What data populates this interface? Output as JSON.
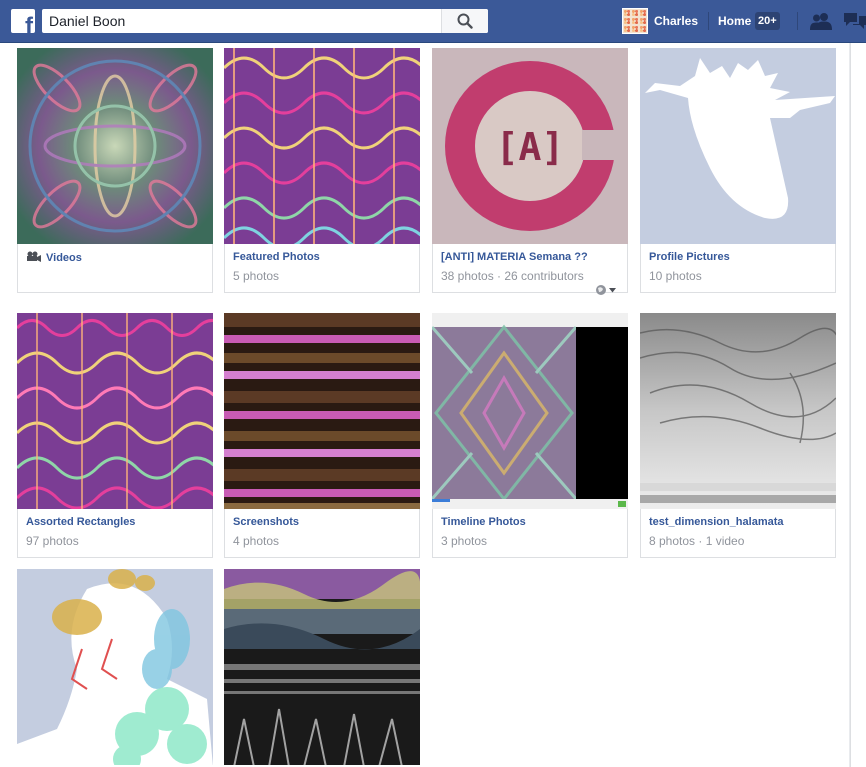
{
  "header": {
    "search_value": "Daniel Boon",
    "user_name": "Charles",
    "home_label": "Home",
    "home_badge": "20+"
  },
  "albums": [
    {
      "title": "Videos",
      "subtitle": "",
      "icon": "video-camera-icon"
    },
    {
      "title": "Featured Photos",
      "subtitle": "5 photos"
    },
    {
      "title": "[ANTI] MATERIA Semana ??",
      "subtitle": "38 photos · 26 contributors",
      "thumb_text": "[A]",
      "icon": "globe-icon"
    },
    {
      "title": "Profile Pictures",
      "subtitle": "10 photos"
    },
    {
      "title": "Assorted Rectangles",
      "subtitle": "97 photos"
    },
    {
      "title": "Screenshots",
      "subtitle": "4 photos"
    },
    {
      "title": "Timeline Photos",
      "subtitle": "3 photos"
    },
    {
      "title": "test_dimension_halamata",
      "subtitle": "8 photos · 1 video"
    },
    {
      "title": "",
      "subtitle": ""
    },
    {
      "title": "",
      "subtitle": ""
    }
  ],
  "colors": {
    "brand": "#3b5998",
    "link": "#365899",
    "muted": "#90949c"
  }
}
